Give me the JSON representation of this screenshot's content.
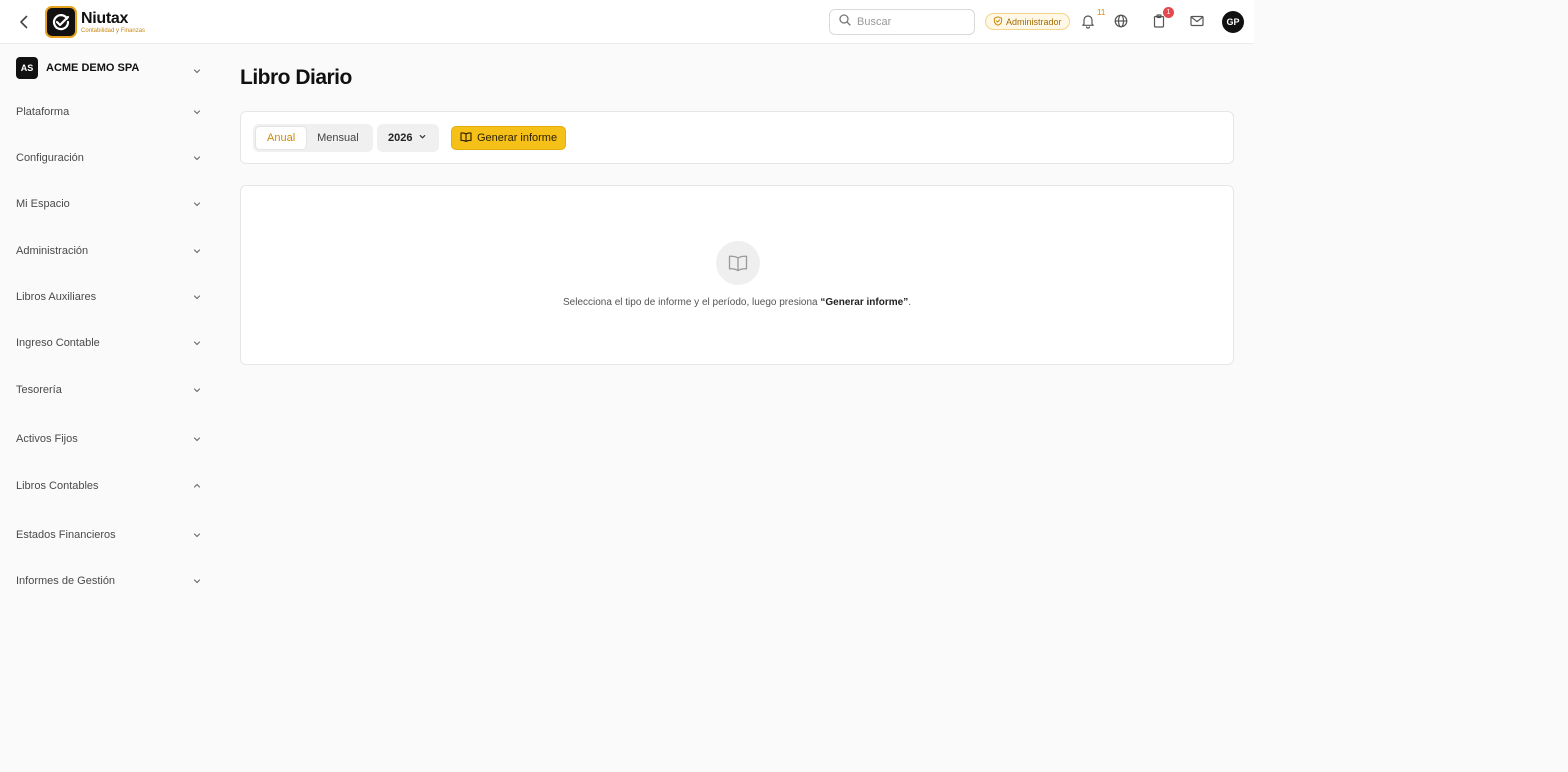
{
  "header": {
    "brand_name": "Niutax",
    "brand_tagline": "Contabilidad y Finanzas",
    "search_placeholder": "Buscar",
    "role_badge": "Administrador",
    "notifications_count": "11",
    "tasks_count": "1",
    "avatar_initials": "GP"
  },
  "sidebar": {
    "company_initials": "AS",
    "company_name": "ACME DEMO SPA",
    "items": [
      {
        "label": "Plataforma",
        "expanded": false
      },
      {
        "label": "Configuración",
        "expanded": false
      },
      {
        "label": "Mi Espacio",
        "expanded": false
      },
      {
        "label": "Administración",
        "expanded": false
      },
      {
        "label": "Libros Auxiliares",
        "expanded": false
      },
      {
        "label": "Ingreso Contable",
        "expanded": false
      },
      {
        "label": "Tesorería",
        "expanded": false
      },
      {
        "label": "Activos Fijos",
        "expanded": false
      },
      {
        "label": "Libros Contables",
        "expanded": true
      },
      {
        "label": "Estados Financieros",
        "expanded": false
      },
      {
        "label": "Informes de Gestión",
        "expanded": false
      }
    ]
  },
  "main": {
    "title": "Libro Diario",
    "period_tabs": [
      {
        "label": "Anual",
        "active": true
      },
      {
        "label": "Mensual",
        "active": false
      }
    ],
    "year_selected": "2026",
    "generate_label": "Generar informe",
    "empty_message_before": "Selecciona el tipo de informe y el período, luego presiona ",
    "empty_message_bold": "“Generar informe”",
    "empty_message_after": "."
  },
  "colors": {
    "accent": "#f5c018",
    "accent_text": "#d08a00",
    "alert": "#e5484d"
  },
  "icons": [
    "back-arrow-icon",
    "niutax-logo-icon",
    "search-icon",
    "shield-check-icon",
    "bell-icon",
    "globe-icon",
    "clipboard-icon",
    "mail-icon",
    "chevron-down-icon",
    "chevron-up-icon",
    "book-open-icon"
  ]
}
